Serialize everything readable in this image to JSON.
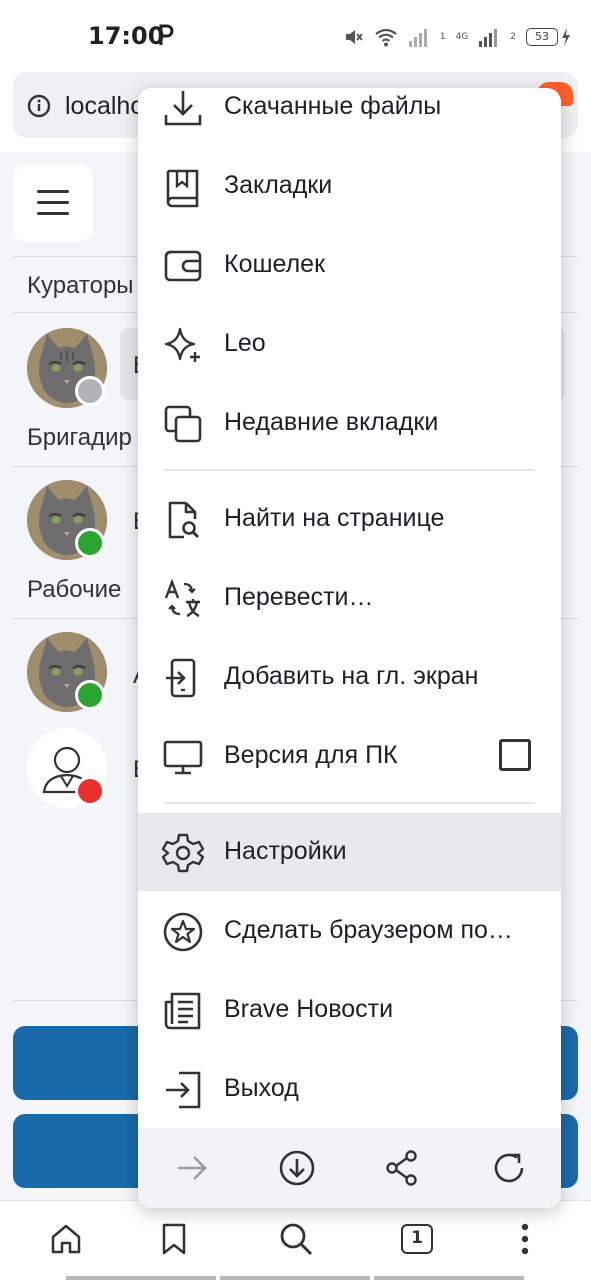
{
  "status_bar": {
    "time": "17:00",
    "network": "4G",
    "sim1": "1",
    "sim2": "2",
    "battery": "53"
  },
  "address_bar": {
    "url_text": "localho"
  },
  "page": {
    "sections": [
      {
        "label": "Кураторы"
      },
      {
        "label": "Бригадир"
      },
      {
        "label": "Рабочие"
      }
    ],
    "rows": [
      {
        "letter": "Б",
        "status_color": "#b0b3b8"
      },
      {
        "letter": "Б",
        "status_color": "#2aa531"
      },
      {
        "letter": "А",
        "status_color": "#2aa531"
      },
      {
        "letter": "Б",
        "status_color": "#e8312f"
      }
    ],
    "accent_color": "#1a6aaa"
  },
  "menu": {
    "items": [
      {
        "label": "Скачанные файлы",
        "icon": "download-icon"
      },
      {
        "label": "Закладки",
        "icon": "bookmarks-icon"
      },
      {
        "label": "Кошелек",
        "icon": "wallet-icon"
      },
      {
        "label": "Leo",
        "icon": "leo-sparkle-icon"
      },
      {
        "label": "Недавние вкладки",
        "icon": "recent-tabs-icon"
      },
      {
        "label": "Найти на странице",
        "icon": "find-in-page-icon"
      },
      {
        "label": "Перевести…",
        "icon": "translate-icon"
      },
      {
        "label": "Добавить на гл. экран",
        "icon": "add-to-home-icon"
      },
      {
        "label": "Версия для ПК",
        "icon": "desktop-icon",
        "checked": false
      },
      {
        "label": "Настройки",
        "icon": "gear-icon",
        "active": true
      },
      {
        "label": "Сделать браузером по…",
        "icon": "star-circle-icon"
      },
      {
        "label": "Brave Новости",
        "icon": "news-icon"
      },
      {
        "label": "Выход",
        "icon": "exit-icon"
      }
    ],
    "footer": [
      "forward-arrow-icon",
      "download-circle-icon",
      "share-icon",
      "reload-icon"
    ]
  },
  "bottom_bar": {
    "tab_count": "1"
  }
}
